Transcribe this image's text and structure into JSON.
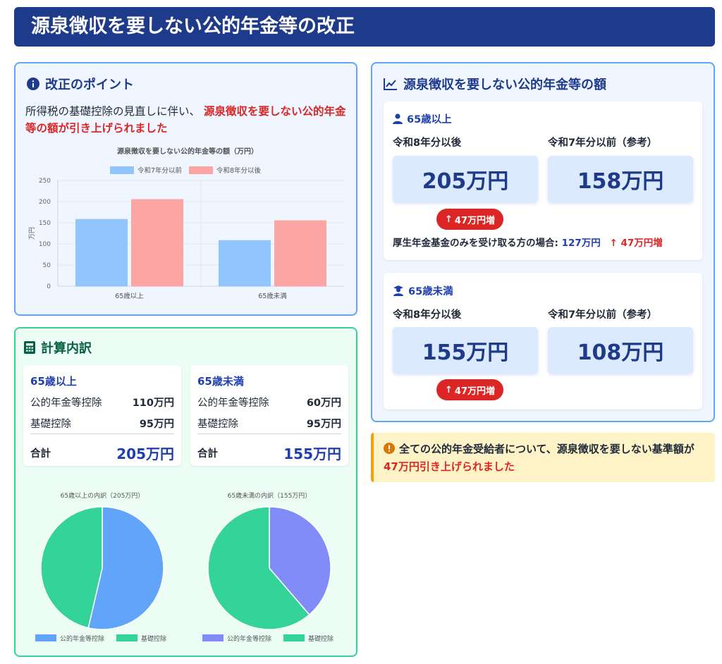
{
  "header": {
    "title": "源泉徴収を要しない公的年金等の改正"
  },
  "point": {
    "title": "改正のポイント",
    "lead_prefix": "所得税の基礎控除の見直しに伴い、",
    "lead_emph": "源泉徴収を要しない公的年金等の額が引き上げられました"
  },
  "calc": {
    "title": "計算内訳",
    "over65": {
      "title": "65歳以上",
      "rows": [
        {
          "label": "公的年金等控除",
          "value": "110万円"
        },
        {
          "label": "基礎控除",
          "value": "95万円"
        }
      ],
      "total_label": "合計",
      "total_value": "205万円"
    },
    "under65": {
      "title": "65歳未満",
      "rows": [
        {
          "label": "公的年金等控除",
          "value": "60万円"
        },
        {
          "label": "基礎控除",
          "value": "95万円"
        }
      ],
      "total_label": "合計",
      "total_value": "155万円"
    }
  },
  "amounts": {
    "title": "源泉徴収を要しない公的年金等の額",
    "over65": {
      "title": "65歳以上",
      "col_after": "令和8年分以後",
      "col_before": "令和7年分以前（参考）",
      "after_value": "205万円",
      "before_value": "158万円",
      "badge": "47万円増",
      "note_prefix": "厚生年金基金のみを受け取る方の場合:",
      "note_value": "127万円",
      "note_badge": "47万円増"
    },
    "under65": {
      "title": "65歳未満",
      "col_after": "令和8年分以後",
      "col_before": "令和7年分以前（参考）",
      "after_value": "155万円",
      "before_value": "108万円",
      "badge": "47万円増"
    }
  },
  "alert": {
    "text_prefix": "全ての公的年金受給者について、源泉徴収を要しない基準額が",
    "text_emph": "47万円引き上げられました"
  },
  "colors": {
    "header": "#1e3a8a",
    "accent_blue": "#1e40af",
    "red": "#dc2626",
    "bar_before": "#93c5fd",
    "bar_after": "#fca5a5",
    "pie_pension": "#60a5fa",
    "pie_basic": "#34d399",
    "pie_pension_under": "#818cf8"
  },
  "chart_data": [
    {
      "type": "bar",
      "title": "源泉徴収を要しない公的年金等の額（万円）",
      "categories": [
        "65歳以上",
        "65歳未満"
      ],
      "series": [
        {
          "name": "令和7年分以前",
          "values": [
            158,
            108
          ],
          "color": "#93c5fd"
        },
        {
          "name": "令和8年分以後",
          "values": [
            205,
            155
          ],
          "color": "#fca5a5"
        }
      ],
      "ylabel": "万円",
      "ylim": [
        0,
        250
      ],
      "yticks": [
        0,
        50,
        100,
        150,
        200,
        250
      ],
      "legend": "top",
      "grid": true
    },
    {
      "type": "pie",
      "title": "65歳以上の内訳（205万円）",
      "labels": [
        "公的年金等控除",
        "基礎控除"
      ],
      "values": [
        110,
        95
      ],
      "colors": [
        "#60a5fa",
        "#34d399"
      ],
      "legend": "bottom"
    },
    {
      "type": "pie",
      "title": "65歳未満の内訳（155万円）",
      "labels": [
        "公的年金等控除",
        "基礎控除"
      ],
      "values": [
        60,
        95
      ],
      "colors": [
        "#818cf8",
        "#34d399"
      ],
      "legend": "bottom"
    }
  ]
}
